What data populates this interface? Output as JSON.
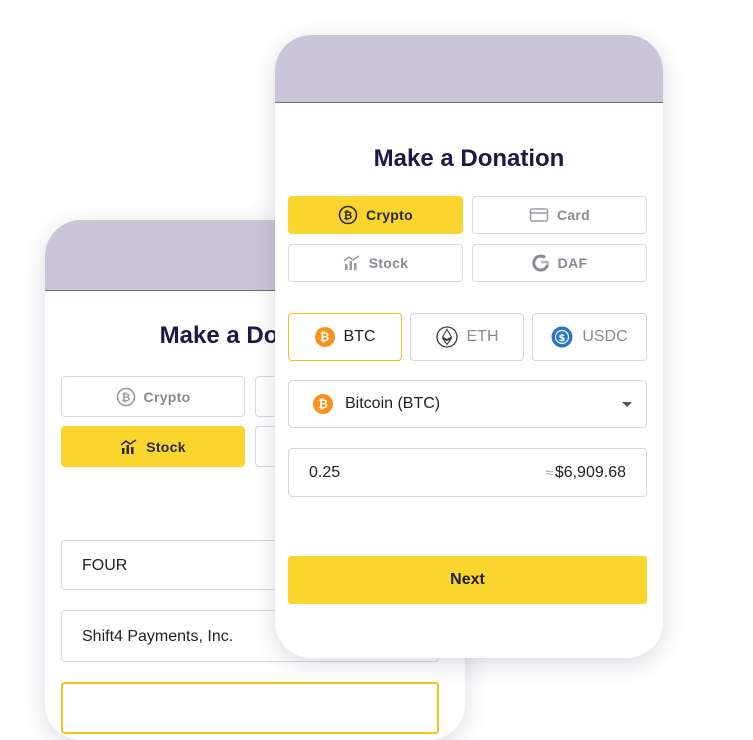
{
  "back_form": {
    "title": "Make a Donation",
    "tabs": [
      {
        "label": "Crypto",
        "icon": "bitcoin-icon",
        "active": false
      },
      {
        "label": "Stock",
        "icon": "stock-chart-icon",
        "active": true
      }
    ],
    "ticker_value": "FOUR",
    "company_value": "Shift4 Payments, Inc."
  },
  "front_form": {
    "title": "Make a Donation",
    "tabs": [
      {
        "label": "Crypto",
        "icon": "bitcoin-icon",
        "active": true
      },
      {
        "label": "Card",
        "icon": "credit-card-icon",
        "active": false
      },
      {
        "label": "Stock",
        "icon": "stock-chart-icon",
        "active": false
      },
      {
        "label": "DAF",
        "icon": "daf-logo-icon",
        "active": false
      }
    ],
    "coins": [
      {
        "label": "BTC",
        "icon": "bitcoin-icon",
        "active": true,
        "color": "#f7931a"
      },
      {
        "label": "ETH",
        "icon": "ethereum-icon",
        "active": false,
        "color": "#3c3c3d"
      },
      {
        "label": "USDC",
        "icon": "usdc-icon",
        "active": false,
        "color": "#2775ca"
      }
    ],
    "currency_select": {
      "label": "Bitcoin (BTC)",
      "icon": "bitcoin-icon"
    },
    "amount": {
      "crypto_value": "0.25",
      "approx_prefix": "≈",
      "usd_value": "$6,909.68"
    },
    "next_label": "Next"
  },
  "colors": {
    "accent_yellow": "#fad52d",
    "header_lavender": "#c9c5d6",
    "title_navy": "#1f1746",
    "bitcoin_orange": "#f7931a",
    "usdc_blue": "#2775ca"
  }
}
